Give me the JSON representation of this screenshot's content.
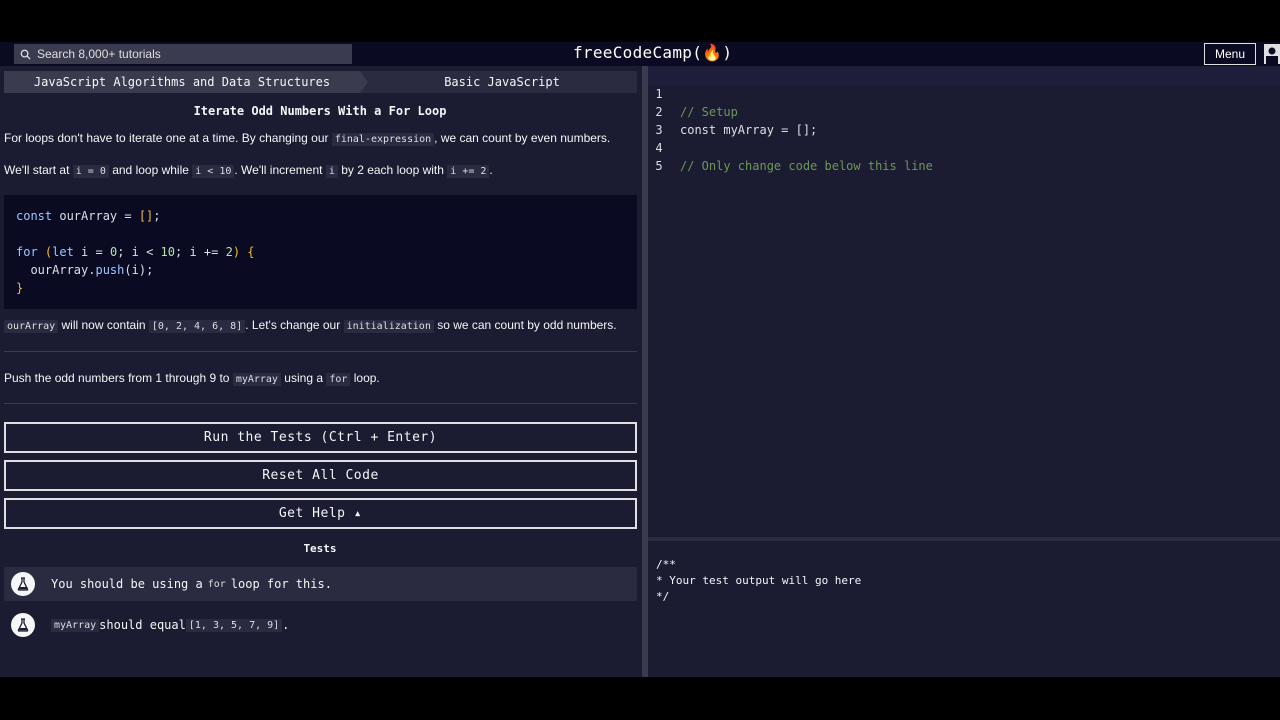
{
  "nav": {
    "search_placeholder": "Search 8,000+ tutorials",
    "logo": "freeCodeCamp(🔥)",
    "menu_label": "Menu"
  },
  "breadcrumbs": [
    "JavaScript Algorithms and Data Structures",
    "Basic JavaScript"
  ],
  "challenge": {
    "title": "Iterate Odd Numbers With a For Loop",
    "p1": {
      "before": "For loops don't have to iterate one at a time. By changing our ",
      "code": "final-expression",
      "after": ", we can count by even numbers."
    },
    "p2": {
      "t1": "We'll start at ",
      "c1": "i = 0",
      "t2": " and loop while ",
      "c2": "i < 10",
      "t3": ". We'll increment ",
      "c3": "i",
      "t4": " by 2 each loop with ",
      "c4": "i += 2",
      "t5": "."
    },
    "example_code": {
      "line1_kw": "const",
      "line1_rest": " ourArray = ",
      "line1_br": "[]",
      "line1_end": ";",
      "line3_kw": "for",
      "line3_p1": " (",
      "line3_let": "let",
      "line3_a": " i = ",
      "line3_zero": "0",
      "line3_b": "; i < ",
      "line3_ten": "10",
      "line3_c": "; i += ",
      "line3_two": "2",
      "line3_d": ") {",
      "line4_a": "  ourArray.",
      "line4_fn": "push",
      "line4_b": "(i);",
      "line5": "}"
    },
    "p3": {
      "c1": "ourArray",
      "t1": " will now contain ",
      "c2": "[0, 2, 4, 6, 8]",
      "t2": ". Let's change our ",
      "c3": "initialization",
      "t3": " so we can count by odd numbers."
    },
    "p4": {
      "t1": "Push the odd numbers from 1 through 9 to ",
      "c1": "myArray",
      "t2": " using a ",
      "c2": "for",
      "t3": " loop."
    }
  },
  "buttons": {
    "run": "Run the Tests (Ctrl + Enter)",
    "reset": "Reset All Code",
    "help": "Get Help ▴"
  },
  "tests": {
    "heading": "Tests",
    "items": [
      {
        "t1": "You should be using a ",
        "c1": "for",
        "t2": " loop for this."
      },
      {
        "c1": "myArray",
        "t1": " should equal ",
        "c2": "[1, 3, 5, 7, 9]",
        "t2": "."
      }
    ]
  },
  "editor": {
    "lines": [
      {
        "num": "1",
        "text": "// Setup"
      },
      {
        "num": "2",
        "text": "const myArray = [];"
      },
      {
        "num": "3",
        "text": ""
      },
      {
        "num": "4",
        "text": "// Only change code below this line"
      },
      {
        "num": "5",
        "text": ""
      }
    ]
  },
  "output": {
    "text": "/**\n* Your test output will go here\n*/"
  },
  "icons": {
    "search": "search-icon",
    "flask": "flask-icon",
    "avatar": "avatar-icon",
    "flame": "flame-icon"
  },
  "colors": {
    "background": "#1b1b32",
    "nav": "#0a0a23",
    "text": "#f5f6f7",
    "comment": "#6a9955"
  }
}
